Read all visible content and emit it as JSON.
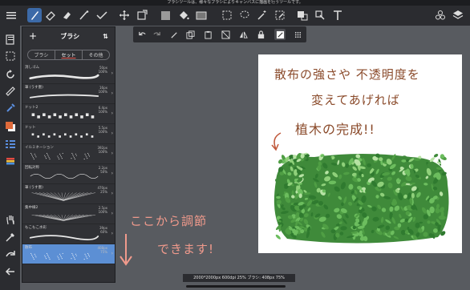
{
  "notice": "ブラシツールは、様々なブラシによりキャンバスに描画を行うツールです。",
  "panel": {
    "title": "ブラシ",
    "add_label": "+",
    "sort_label": "⇅",
    "tabs": [
      {
        "label": "ブラシ",
        "active": false
      },
      {
        "label": "セット",
        "active": true
      },
      {
        "label": "その他",
        "active": false
      }
    ],
    "brushes": [
      {
        "name": "消しゴム",
        "size": "50px",
        "opacity": "100%",
        "selected": false
      },
      {
        "name": "筆 (うす墨)",
        "size": "16px",
        "opacity": "100%",
        "selected": false
      },
      {
        "name": "ドット2",
        "size": "6.4px",
        "opacity": "100%",
        "selected": false
      },
      {
        "name": "ドット",
        "size": "5.5px",
        "opacity": "100%",
        "selected": false
      },
      {
        "name": "イルミネーション",
        "size": "392px",
        "opacity": "100%",
        "selected": false
      },
      {
        "name": "回転対称",
        "size": "2.2px",
        "opacity": "50%",
        "selected": false
      },
      {
        "name": "筆 (うす墨)",
        "size": "470px",
        "opacity": "25%",
        "selected": false
      },
      {
        "name": "集中線2",
        "size": "2.5px",
        "opacity": "100%",
        "selected": false
      },
      {
        "name": "もこもこ水彩",
        "size": "39px",
        "opacity": "60%",
        "selected": false
      },
      {
        "name": "散布",
        "size": "408px",
        "opacity": "75%",
        "selected": true
      }
    ]
  },
  "canvas_text": {
    "line1": "散布の強さや 不透明度を",
    "line2": "変えてあげれば",
    "line3": "植木の完成!!"
  },
  "annotation": {
    "line1": "ここから調節",
    "line2": "できます!"
  },
  "status": "2000*2000px 600dpi 25% ブラシ: 408px 75%",
  "colors": {
    "accent": "#5c8fd4",
    "handwriting": "#8a4a2a",
    "annotation": "#f09a8c",
    "bush_dark": "#3f8a3a",
    "bush_light": "#8fd07a"
  }
}
